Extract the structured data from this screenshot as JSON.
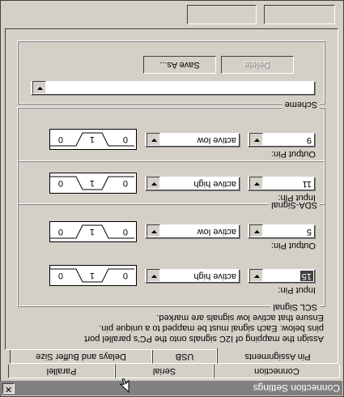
{
  "window": {
    "title": "Connection Settings",
    "close_glyph": "✕"
  },
  "tabs_row_back": [
    "Connection",
    "Serial",
    "Parallel"
  ],
  "tabs_row_front": [
    "Pin Assignments",
    "USB",
    "Delays and Buffer Size"
  ],
  "description": [
    "Assign the mapping of I2C signals onto the PC's parallel port",
    "pins below.  Each signal must be mapped to a unique pin.",
    "Ensure that active low signals are marked."
  ],
  "scl": {
    "legend": "SCL Signal",
    "input_label": "Input Pin:",
    "input_pin": "15",
    "input_polarity": "active high",
    "output_label": "Output Pin:",
    "output_pin": "5",
    "output_polarity": "active low"
  },
  "sda": {
    "legend": "SDA-Signal",
    "input_label": "Input Pin:",
    "input_pin": "11",
    "input_polarity": "active high",
    "output_label": "Output Pin:",
    "output_pin": "9",
    "output_polarity": "active low"
  },
  "wave_labels": {
    "left": "0",
    "mid": "1",
    "right": "0"
  },
  "scheme": {
    "legend": "Scheme",
    "value": "",
    "save_as_label": "Save As...",
    "delete_label": "Delete"
  }
}
